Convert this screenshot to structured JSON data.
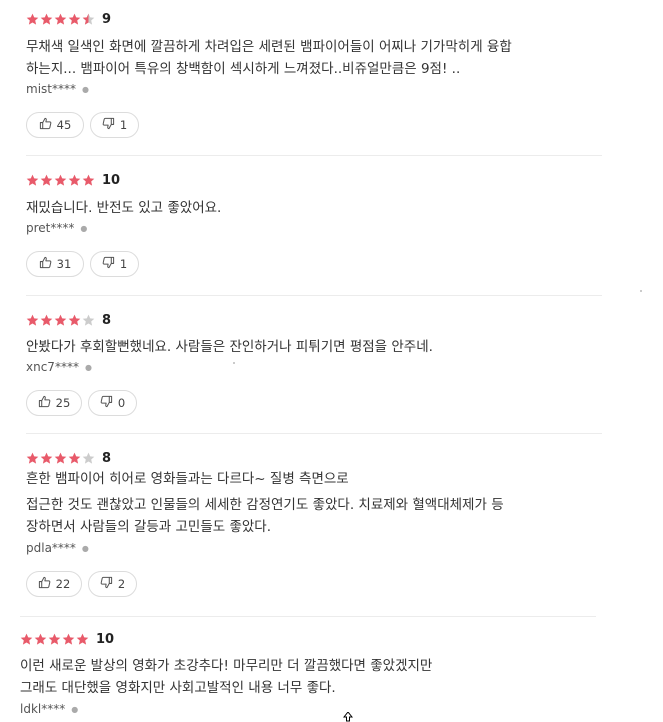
{
  "colors": {
    "star_filled": "#e85a6a",
    "star_empty": "#cccccc"
  },
  "reviews": [
    {
      "stars": "4.5",
      "score": "9",
      "lines": [
        "무채색 일색인 화면에 깔끔하게 차려입은 세련된 뱀파이어들이 어찌나 기가막히게 융합",
        "하는지... 뱀파이어 특유의 창백함이 섹시하게 느껴졌다..비쥬얼만큼은 9점! .."
      ],
      "author": "mist****",
      "likes": "45",
      "dislikes": "1"
    },
    {
      "stars": "5",
      "score": "10",
      "lines": [
        "재밌습니다. 반전도 있고 좋았어요."
      ],
      "author": "pret****",
      "likes": "31",
      "dislikes": "1"
    },
    {
      "stars": "4",
      "score": "8",
      "lines": [
        "안봤다가 후회할뻔했네요. 사람들은 잔인하거나 피튀기면 평점을 안주네."
      ],
      "author": "xnc7****",
      "likes": "25",
      "dislikes": "0"
    },
    {
      "stars": "4",
      "score": "8",
      "lines": [
        "흔한 뱀파이어 히어로 영화들과는 다르다~ 질병 측면으로",
        "접근한 것도 괜찮았고 인물들의 세세한 감정연기도 좋았다. 치료제와 혈액대체제가 등",
        "장하면서 사람들의 갈등과 고민들도 좋았다."
      ],
      "author": "pdla****",
      "likes": "22",
      "dislikes": "2"
    },
    {
      "stars": "5",
      "score": "10",
      "lines": [
        "이런 새로운 발상의 영화가 초강추다! 마무리만 더 깔끔했다면 좋았겠지만",
        "그래도 대단했을 영화지만 사회고발적인 내용 너무 좋다."
      ],
      "author": "ldkl****"
    }
  ]
}
